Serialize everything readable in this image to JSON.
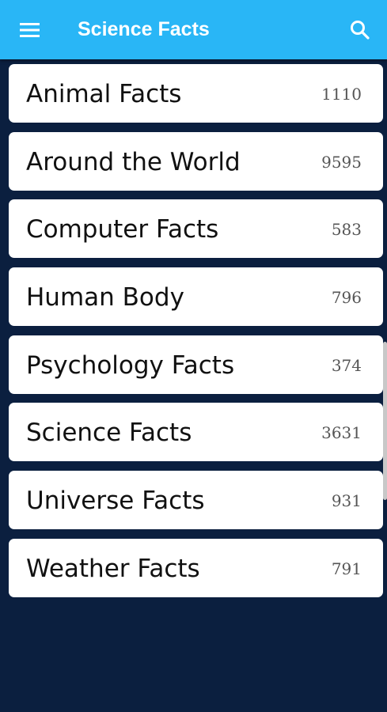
{
  "app_bar": {
    "title": "Science Facts",
    "menu_icon": "hamburger-menu-icon",
    "search_icon": "search-icon",
    "bar_color": "#29b6f6"
  },
  "theme": {
    "background": "#0b1f3f",
    "card": "#ffffff"
  },
  "categories": [
    {
      "label": "Animal Facts",
      "count": "1110"
    },
    {
      "label": "Around the World",
      "count": "9595"
    },
    {
      "label": "Computer Facts",
      "count": "583"
    },
    {
      "label": "Human Body",
      "count": "796"
    },
    {
      "label": "Psychology Facts",
      "count": "374"
    },
    {
      "label": "Science Facts",
      "count": "3631"
    },
    {
      "label": "Universe Facts",
      "count": "931"
    },
    {
      "label": "Weather Facts",
      "count": "791"
    }
  ]
}
